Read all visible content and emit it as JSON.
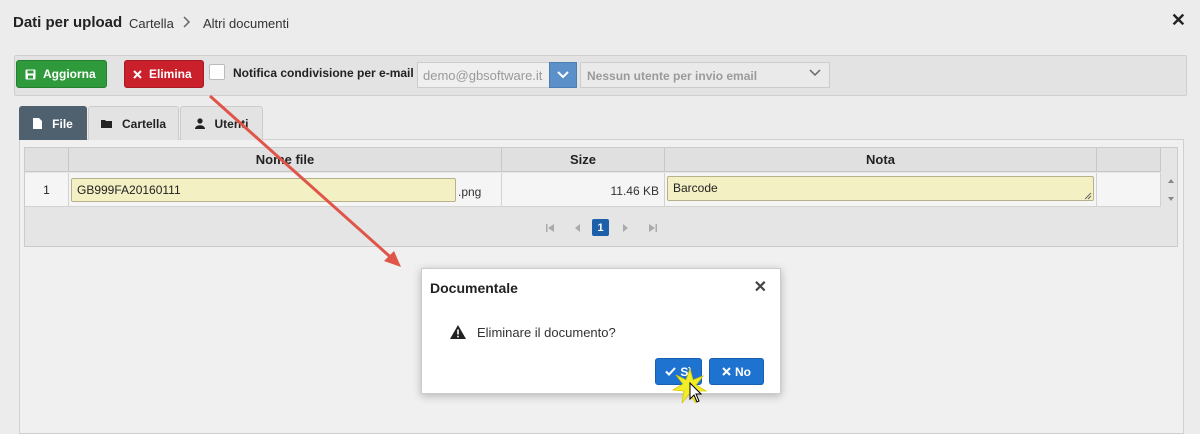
{
  "header": {
    "title": "Dati per upload",
    "breadcrumb": [
      "Cartella",
      "Altri documenti"
    ]
  },
  "toolbar": {
    "update_label": "Aggiorna",
    "delete_label": "Elimina",
    "notify_label": "Notifica condivisione per e-mail",
    "email_value": "demo@gbsoftware.it",
    "user_placeholder": "Nessun utente per invio email"
  },
  "tabs": [
    {
      "label": "File",
      "active": true
    },
    {
      "label": "Cartella",
      "active": false
    },
    {
      "label": "Utenti",
      "active": false
    }
  ],
  "grid": {
    "columns": [
      "Nome file",
      "Size",
      "Nota"
    ],
    "rows": [
      {
        "num": "1",
        "filename": "GB999FA20160111",
        "extension": ".png",
        "size": "11.46 KB",
        "note": "Barcode"
      }
    ],
    "current_page": "1"
  },
  "dialog": {
    "title": "Documentale",
    "message": "Eliminare il documento?",
    "yes_label": "Sì",
    "no_label": "No"
  },
  "colors": {
    "green_button": "#2f9a3c",
    "red_button": "#c9202b",
    "dialog_button": "#1f73d0",
    "active_tab": "#4f616f",
    "annotation_arrow": "#e0554a"
  }
}
